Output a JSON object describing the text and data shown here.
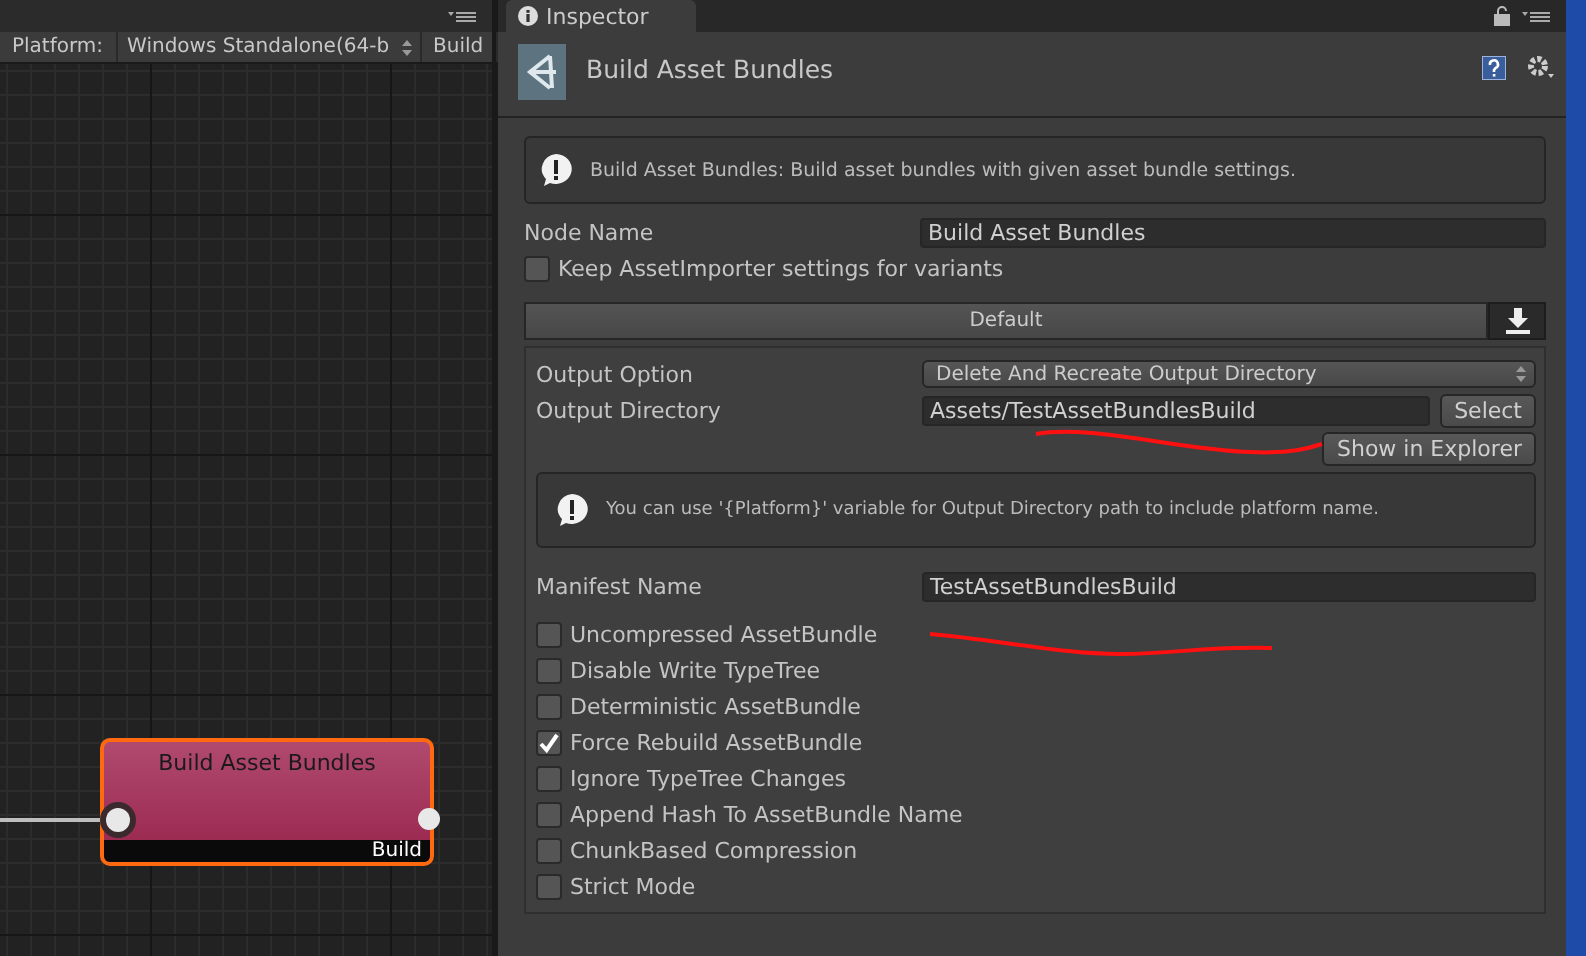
{
  "graph": {
    "toolbar": {
      "platform_label": "Platform:",
      "platform": "Windows Standalone(64-b",
      "build_button": "Build"
    },
    "node": {
      "title": "Build Asset Bundles",
      "footer": "Build",
      "selected": true
    }
  },
  "inspector": {
    "tab": "Inspector",
    "title": "Build Asset Bundles",
    "info": "Build Asset Bundles: Build asset bundles with given asset bundle settings.",
    "node_name": {
      "label": "Node Name",
      "value": "Build Asset Bundles"
    },
    "keep_settings": {
      "label": "Keep AssetImporter settings for variants",
      "checked": false
    },
    "platform_tab": "Default",
    "output_option": {
      "label": "Output Option",
      "value": "Delete And Recreate Output Directory"
    },
    "output_directory": {
      "label": "Output Directory",
      "value": "Assets/TestAssetBundlesBuild",
      "select_button": "Select",
      "show_button": "Show in Explorer"
    },
    "hint": "You can use '{Platform}' variable for Output Directory path to include platform name.",
    "manifest": {
      "label": "Manifest Name",
      "value": "TestAssetBundlesBuild"
    },
    "options": [
      {
        "label": "Uncompressed AssetBundle",
        "checked": false
      },
      {
        "label": "Disable Write TypeTree",
        "checked": false
      },
      {
        "label": "Deterministic AssetBundle",
        "checked": false
      },
      {
        "label": "Force Rebuild AssetBundle",
        "checked": true
      },
      {
        "label": "Ignore TypeTree Changes",
        "checked": false
      },
      {
        "label": "Append Hash To AssetBundle Name",
        "checked": false
      },
      {
        "label": "ChunkBased Compression",
        "checked": false
      },
      {
        "label": "Strict Mode",
        "checked": false
      }
    ]
  }
}
